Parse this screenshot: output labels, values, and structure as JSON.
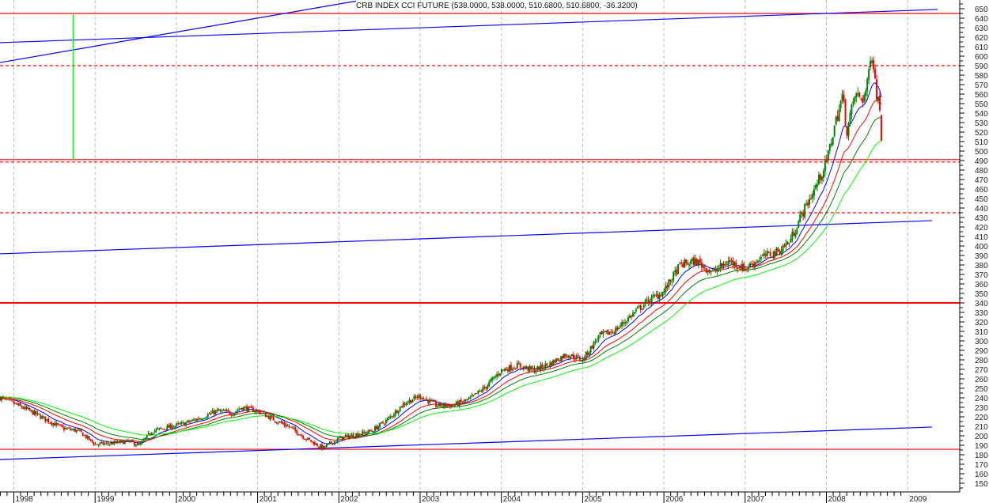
{
  "chart_data": {
    "type": "candlestick",
    "title": "CRB INDEX CCI FUTURE (538.0000, 538.0000, 510.6800, 510.6800, -36.3200)",
    "last_bar": {
      "open": 538.0,
      "high": 538.0,
      "low": 510.68,
      "close": 510.68,
      "change": -36.32
    },
    "xlabel": "",
    "ylabel": "",
    "x_range": [
      1997.83,
      2009.6
    ],
    "ylim": [
      143,
      660
    ],
    "y_ticks": [
      150,
      160,
      170,
      180,
      190,
      200,
      210,
      220,
      230,
      240,
      250,
      260,
      270,
      280,
      290,
      300,
      310,
      320,
      330,
      340,
      350,
      360,
      370,
      380,
      390,
      400,
      410,
      420,
      430,
      440,
      450,
      460,
      470,
      480,
      490,
      500,
      510,
      520,
      530,
      540,
      550,
      560,
      570,
      580,
      590,
      600,
      610,
      620,
      630,
      640,
      650
    ],
    "x_ticks": [
      {
        "t": 1998,
        "label": "1998"
      },
      {
        "t": 1999,
        "label": "1999"
      },
      {
        "t": 2000,
        "label": "2000"
      },
      {
        "t": 2001,
        "label": "2001"
      },
      {
        "t": 2002,
        "label": "2002"
      },
      {
        "t": 2003,
        "label": "2003"
      },
      {
        "t": 2004,
        "label": "2004"
      },
      {
        "t": 2005,
        "label": "2005"
      },
      {
        "t": 2006,
        "label": "2006"
      },
      {
        "t": 2007,
        "label": "2007"
      },
      {
        "t": 2008,
        "label": "2008"
      },
      {
        "t": 2009,
        "label": "2009"
      }
    ],
    "grid": {
      "vertical_years": true,
      "horizontal": false
    },
    "price_path": [
      [
        1997.83,
        240
      ],
      [
        1998.0,
        234
      ],
      [
        1998.2,
        226
      ],
      [
        1998.4,
        217
      ],
      [
        1998.6,
        208
      ],
      [
        1998.8,
        205
      ],
      [
        1999.0,
        191
      ],
      [
        1999.2,
        192
      ],
      [
        1999.4,
        194
      ],
      [
        1999.55,
        190
      ],
      [
        1999.7,
        205
      ],
      [
        1999.9,
        209
      ],
      [
        2000.1,
        213
      ],
      [
        2000.3,
        219
      ],
      [
        2000.5,
        226
      ],
      [
        2000.7,
        224
      ],
      [
        2000.8,
        230
      ],
      [
        2001.0,
        226
      ],
      [
        2001.2,
        217
      ],
      [
        2001.4,
        209
      ],
      [
        2001.6,
        197
      ],
      [
        2001.8,
        187
      ],
      [
        2002.0,
        197
      ],
      [
        2002.2,
        201
      ],
      [
        2002.4,
        205
      ],
      [
        2002.6,
        217
      ],
      [
        2002.8,
        234
      ],
      [
        2003.0,
        242
      ],
      [
        2003.2,
        232
      ],
      [
        2003.4,
        232
      ],
      [
        2003.6,
        238
      ],
      [
        2003.8,
        251
      ],
      [
        2004.0,
        269
      ],
      [
        2004.2,
        274
      ],
      [
        2004.4,
        269
      ],
      [
        2004.6,
        276
      ],
      [
        2004.8,
        286
      ],
      [
        2005.0,
        280
      ],
      [
        2005.2,
        305
      ],
      [
        2005.4,
        311
      ],
      [
        2005.6,
        327
      ],
      [
        2005.8,
        342
      ],
      [
        2006.0,
        352
      ],
      [
        2006.2,
        380
      ],
      [
        2006.4,
        384
      ],
      [
        2006.6,
        372
      ],
      [
        2006.8,
        384
      ],
      [
        2007.0,
        376
      ],
      [
        2007.2,
        388
      ],
      [
        2007.4,
        394
      ],
      [
        2007.55,
        405
      ],
      [
        2007.7,
        434
      ],
      [
        2007.85,
        459
      ],
      [
        2008.0,
        488
      ],
      [
        2008.1,
        526
      ],
      [
        2008.2,
        559
      ],
      [
        2008.25,
        520
      ],
      [
        2008.35,
        559
      ],
      [
        2008.45,
        555
      ],
      [
        2008.5,
        567
      ],
      [
        2008.55,
        608
      ],
      [
        2008.58,
        590
      ],
      [
        2008.62,
        559
      ],
      [
        2008.66,
        545
      ],
      [
        2008.68,
        510.68
      ]
    ],
    "moving_averages": [
      {
        "name": "ma-fast",
        "period": 13,
        "color": "#0000ff"
      },
      {
        "name": "ma-medium",
        "period": 26,
        "color": "#ff0000"
      },
      {
        "name": "ma-slow",
        "period": 40,
        "color": "#008000"
      },
      {
        "name": "ma-long",
        "period": 62,
        "color": "#00ff00"
      }
    ],
    "horizontal_lines": [
      {
        "value": 645,
        "color": "#ff0000",
        "style": "solid"
      },
      {
        "value": 590,
        "color": "#ff0000",
        "style": "dashed"
      },
      {
        "value": 491,
        "color": "#ff0000",
        "style": "solid"
      },
      {
        "value": 488.5,
        "color": "#ff0000",
        "style": "dashed"
      },
      {
        "value": 435,
        "color": "#ff0000",
        "style": "dashed"
      },
      {
        "value": 340,
        "color": "#ff0000",
        "style": "thick"
      },
      {
        "value": 185.8,
        "color": "#ff0000",
        "style": "solid"
      }
    ],
    "trend_lines": [
      {
        "from": [
          1997.83,
          593.3
        ],
        "to": [
          2002.21,
          658
        ],
        "color": "#0000ff"
      },
      {
        "from": [
          1997.83,
          614.2
        ],
        "to": [
          2009.37,
          649.2
        ],
        "color": "#0000ff"
      },
      {
        "from": [
          1997.83,
          391.7
        ],
        "to": [
          2009.3,
          426.7
        ],
        "color": "#0000ff"
      },
      {
        "from": [
          1997.83,
          175.0
        ],
        "to": [
          2009.3,
          209.2
        ],
        "color": "#0000ff"
      }
    ],
    "vertical_markers": [
      {
        "t": 1998.73,
        "from": 644,
        "to": 491,
        "color": "#00ff00"
      }
    ],
    "colors": {
      "up": "#008000",
      "down": "#ff0000",
      "grid": "#bbbbbb",
      "axis": "#000000"
    }
  }
}
